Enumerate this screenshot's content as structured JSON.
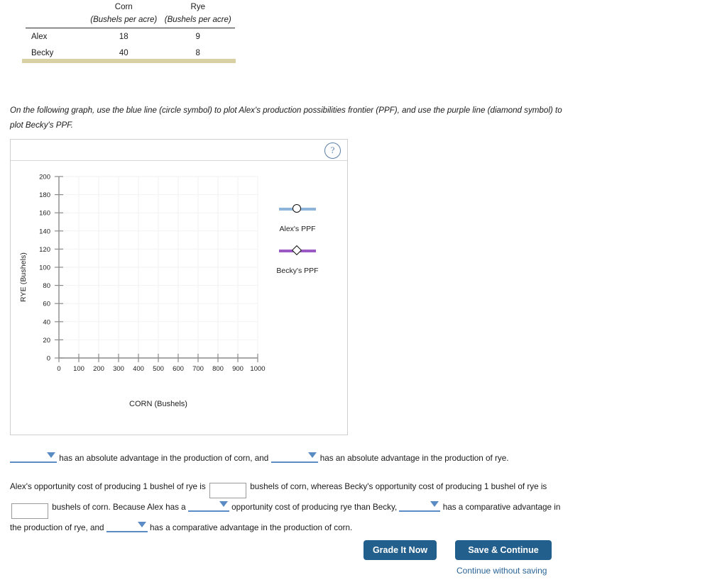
{
  "table": {
    "columns": [
      {
        "title": "Corn",
        "sub": "(Bushels per acre)"
      },
      {
        "title": "Rye",
        "sub": "(Bushels per acre)"
      }
    ],
    "rows": [
      {
        "name": "Alex",
        "corn": "18",
        "rye": "9"
      },
      {
        "name": "Becky",
        "corn": "40",
        "rye": "8"
      }
    ]
  },
  "instructions": "On the following graph, use the blue line (circle symbol) to plot Alex's production possibilities frontier (PPF), and use the purple line (diamond symbol) to plot Becky's PPF.",
  "graph": {
    "help_icon": "?",
    "x_axis_title": "CORN (Bushels)",
    "y_axis_title": "RYE (Bushels)",
    "legend": [
      {
        "label": "Alex's PPF",
        "symbol": "circle",
        "color": "#8fb4d9"
      },
      {
        "label": "Becky's PPF",
        "symbol": "diamond",
        "color": "#9b59c4"
      }
    ]
  },
  "chart_data": {
    "type": "line",
    "title": "",
    "xlabel": "CORN (Bushels)",
    "ylabel": "RYE (Bushels)",
    "xlim": [
      0,
      1000
    ],
    "ylim": [
      0,
      200
    ],
    "xticks": [
      0,
      100,
      200,
      300,
      400,
      500,
      600,
      700,
      800,
      900,
      1000
    ],
    "yticks": [
      0,
      20,
      40,
      60,
      80,
      100,
      120,
      140,
      160,
      180,
      200
    ],
    "grid": true,
    "legend_position": "right",
    "series": [
      {
        "name": "Alex's PPF",
        "color": "#8fb4d9",
        "marker": "circle",
        "x": [],
        "y": []
      },
      {
        "name": "Becky's PPF",
        "color": "#9b59c4",
        "marker": "diamond",
        "x": [],
        "y": []
      }
    ]
  },
  "absolute_advantage": {
    "text_1": "has an absolute advantage in the production of corn, and",
    "text_2": "has an absolute advantage in the production of rye.",
    "dropdown_1_value": "",
    "dropdown_2_value": ""
  },
  "comparative": {
    "text_1": "Alex's opportunity cost of producing 1 bushel of rye is",
    "text_2": "bushels of corn, whereas Becky's opportunity cost of producing 1 bushel of rye is",
    "text_3": "bushels of corn. Because Alex has a",
    "text_4": "opportunity cost of producing rye than Becky,",
    "text_5": "has a comparative advantage in the production of rye, and",
    "text_6": "has a comparative advantage in the production of corn.",
    "input_1_value": "",
    "input_2_value": "",
    "dropdown_cost_value": "",
    "dropdown_rye_value": "",
    "dropdown_corn_value": ""
  },
  "footer": {
    "grade_label": "Grade It Now",
    "save_label": "Save & Continue",
    "continue_link": "Continue without saving"
  }
}
